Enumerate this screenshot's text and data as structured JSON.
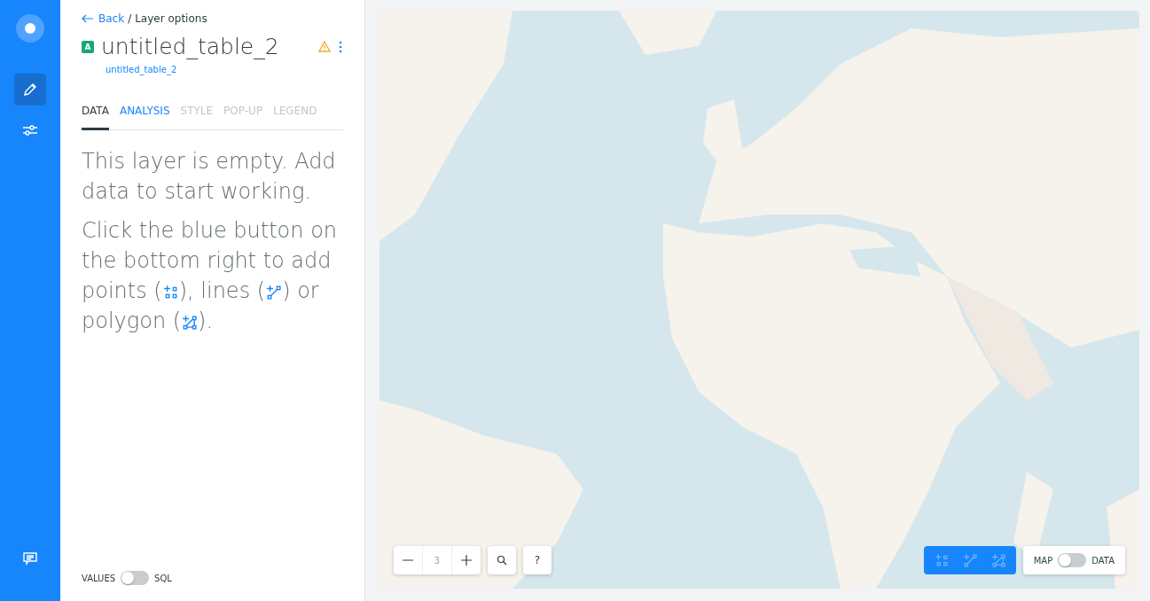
{
  "breadcrumb": {
    "back": "Back",
    "separator": "/",
    "current": "Layer options"
  },
  "layer": {
    "badge": "A",
    "title": "untitled_table_2",
    "source": "untitled_table_2"
  },
  "tabs": [
    {
      "label": "DATA",
      "selected": true,
      "disabled": false
    },
    {
      "label": "ANALYSIS",
      "selected": false,
      "disabled": false
    },
    {
      "label": "STYLE",
      "selected": false,
      "disabled": true
    },
    {
      "label": "POP-UP",
      "selected": false,
      "disabled": true
    },
    {
      "label": "LEGEND",
      "selected": false,
      "disabled": true
    }
  ],
  "empty_message": "This layer is empty. Add data to start working.",
  "instructions": [
    "Click the blue button on the bottom right to add points (",
    "), lines (",
    ") or polygon (",
    ")."
  ],
  "query_toggle": {
    "left": "VALUES",
    "right": "SQL",
    "on": false
  },
  "map": {
    "kind": "picture",
    "zoom_level": "3",
    "help": "?",
    "draw_tools": [
      {
        "disabled": true
      },
      {
        "disabled": true
      },
      {
        "disabled": true
      }
    ],
    "view_toggle": {
      "left": "MAP",
      "right": "DATA",
      "on": false
    }
  }
}
